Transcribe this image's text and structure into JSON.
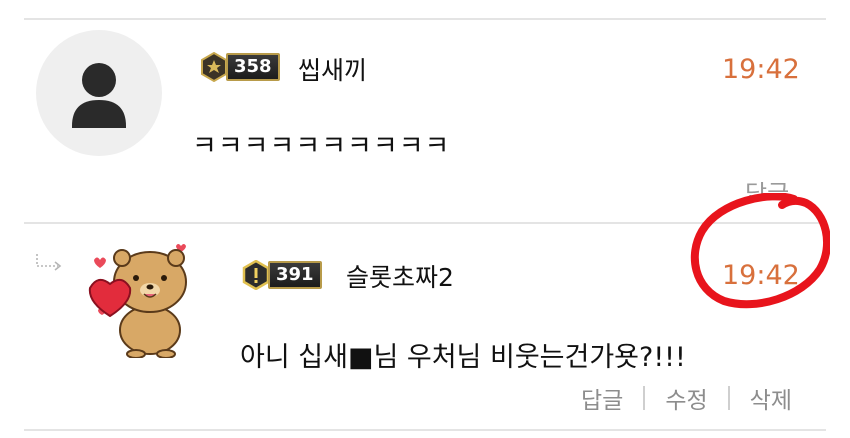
{
  "comments": [
    {
      "level": "358",
      "nickname": "씹새끼",
      "time": "19:42",
      "text": "ㅋㅋㅋㅋㅋㅋㅋㅋㅋㅋ",
      "reply_label": "답글"
    },
    {
      "level": "391",
      "nickname": "슬롯초짜2",
      "time": "19:42",
      "text": "아니 십새■님 우처님 비웃는건가욧?!!!",
      "actions": [
        "답글",
        "수정",
        "삭제"
      ]
    }
  ],
  "annotation": {
    "color": "#e8141c"
  },
  "colors": {
    "time": "#d8703c",
    "muted": "#8d8d8d"
  }
}
